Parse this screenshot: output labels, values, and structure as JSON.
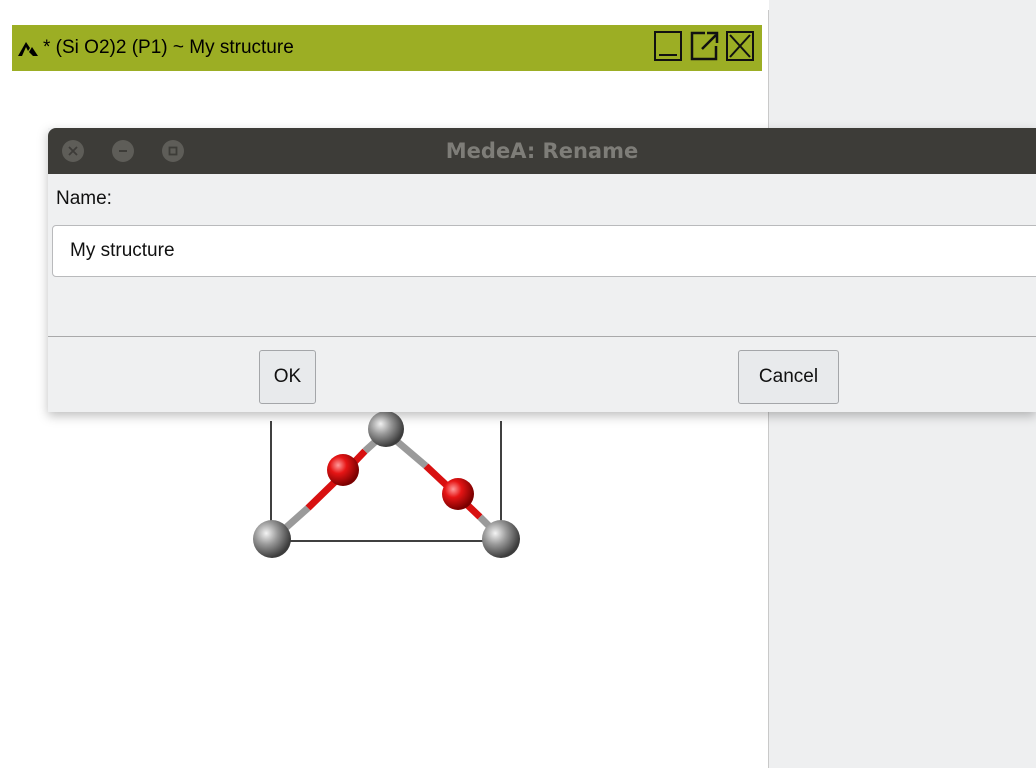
{
  "structure_window": {
    "title": "* (Si O2)2  (P1) ~ My structure",
    "titlebar_color": "#9cae24",
    "icons": [
      "medea-logo-icon",
      "minimize-icon",
      "detach-icon",
      "close-icon"
    ]
  },
  "dialog": {
    "title": "MedeA: Rename",
    "name_label": "Name:",
    "name_value": "My structure",
    "ok_label": "OK",
    "cancel_label": "Cancel",
    "titlebar_icons": [
      "close-icon",
      "minimize-icon",
      "maximize-icon"
    ]
  },
  "molecule": {
    "atom_colors": {
      "Si": "#8c8c8c",
      "O": "#e01010"
    }
  }
}
